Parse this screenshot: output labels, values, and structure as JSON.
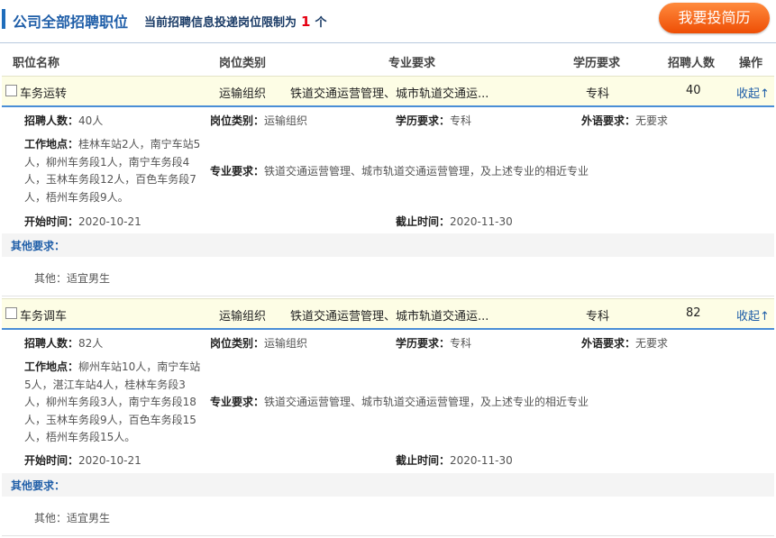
{
  "header": {
    "title": "公司全部招聘职位",
    "note_prefix": "当前招聘信息投递岗位限制为",
    "note_number": "1",
    "note_suffix": "个",
    "apply_label": "我要投简历"
  },
  "columns": [
    "职位名称",
    "岗位类别",
    "专业要求",
    "学历要求",
    "招聘人数",
    "操作"
  ],
  "jobs": [
    {
      "name": "车务运转",
      "category": "运输组织",
      "major_short": "铁道交通运营管理、城市轨道交通运...",
      "education": "专科",
      "count": "40",
      "action": "收起↑",
      "detail": {
        "count_label": "招聘人数：",
        "count_value": "40人",
        "category_label": "岗位类别：",
        "category_value": "运输组织",
        "edu_label": "学历要求：",
        "edu_value": "专科",
        "lang_label": "外语要求：",
        "lang_value": "无要求",
        "location_label": "工作地点：",
        "location_value": "桂林车站2人，南宁车站5人，柳州车务段1人，南宁车务段4人，玉林车务段12人，百色车务段7人，梧州车务段9人。",
        "major_label": "专业要求：",
        "major_value": "铁道交通运营管理、城市轨道交通运营管理，及上述专业的相近专业",
        "start_label": "开始时间：",
        "start_value": "2020-10-21",
        "end_label": "截止时间：",
        "end_value": "2020-11-30",
        "other_label": "其他要求：",
        "other_value": "其他：适宜男生"
      }
    },
    {
      "name": "车务调车",
      "category": "运输组织",
      "major_short": "铁道交通运营管理、城市轨道交通运...",
      "education": "专科",
      "count": "82",
      "action": "收起↑",
      "detail": {
        "count_label": "招聘人数：",
        "count_value": "82人",
        "category_label": "岗位类别：",
        "category_value": "运输组织",
        "edu_label": "学历要求：",
        "edu_value": "专科",
        "lang_label": "外语要求：",
        "lang_value": "无要求",
        "location_label": "工作地点：",
        "location_value": "柳州车站10人，南宁车站5人，湛江车站4人，桂林车务段3人，柳州车务段3人，南宁车务段18人，玉林车务段9人，百色车务段15人，梧州车务段15人。",
        "major_label": "专业要求：",
        "major_value": "铁道交通运营管理、城市轨道交通运营管理，及上述专业的相近专业",
        "start_label": "开始时间：",
        "start_value": "2020-10-21",
        "end_label": "截止时间：",
        "end_value": "2020-11-30",
        "other_label": "其他要求：",
        "other_value": "其他：适宜男生"
      }
    }
  ]
}
